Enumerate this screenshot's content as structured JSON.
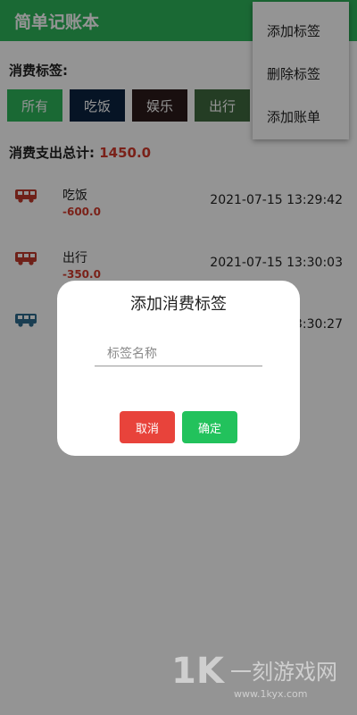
{
  "app": {
    "title": "简单记账本",
    "appbar_color": "#2eb55b"
  },
  "filter": {
    "label": "消费标签:",
    "tags": [
      {
        "label": "所有",
        "color": "#2eb55b"
      },
      {
        "label": "吃饭",
        "color": "#0c2440"
      },
      {
        "label": "娱乐",
        "color": "#2b1a1a"
      },
      {
        "label": "出行",
        "color": "#3f6a3f"
      }
    ]
  },
  "summary": {
    "label": "消费支出总计:",
    "value": "1450.0"
  },
  "records": [
    {
      "name": "吃饭",
      "amount": "-600.0",
      "time": "2021-07-15 13:29:42",
      "icon": "bus-icon",
      "icon_color": "#c0392b"
    },
    {
      "name": "出行",
      "amount": "-350.0",
      "time": "2021-07-15 13:30:03",
      "icon": "bus-icon",
      "icon_color": "#c0392b"
    },
    {
      "name": "",
      "amount": "",
      "time": "3:30:27",
      "icon": "bus-icon",
      "icon_color": "#2e6c8e"
    }
  ],
  "menu": {
    "items": [
      "添加标签",
      "删除标签",
      "添加账单"
    ]
  },
  "dialog": {
    "title": "添加消费标签",
    "input_placeholder": "标签名称",
    "cancel_label": "取消",
    "confirm_label": "确定",
    "cancel_color": "#e8433b",
    "confirm_color": "#22c25c"
  },
  "watermark": {
    "logo": "1K",
    "text": "一刻游戏网",
    "url": "www.1kyx.com"
  }
}
